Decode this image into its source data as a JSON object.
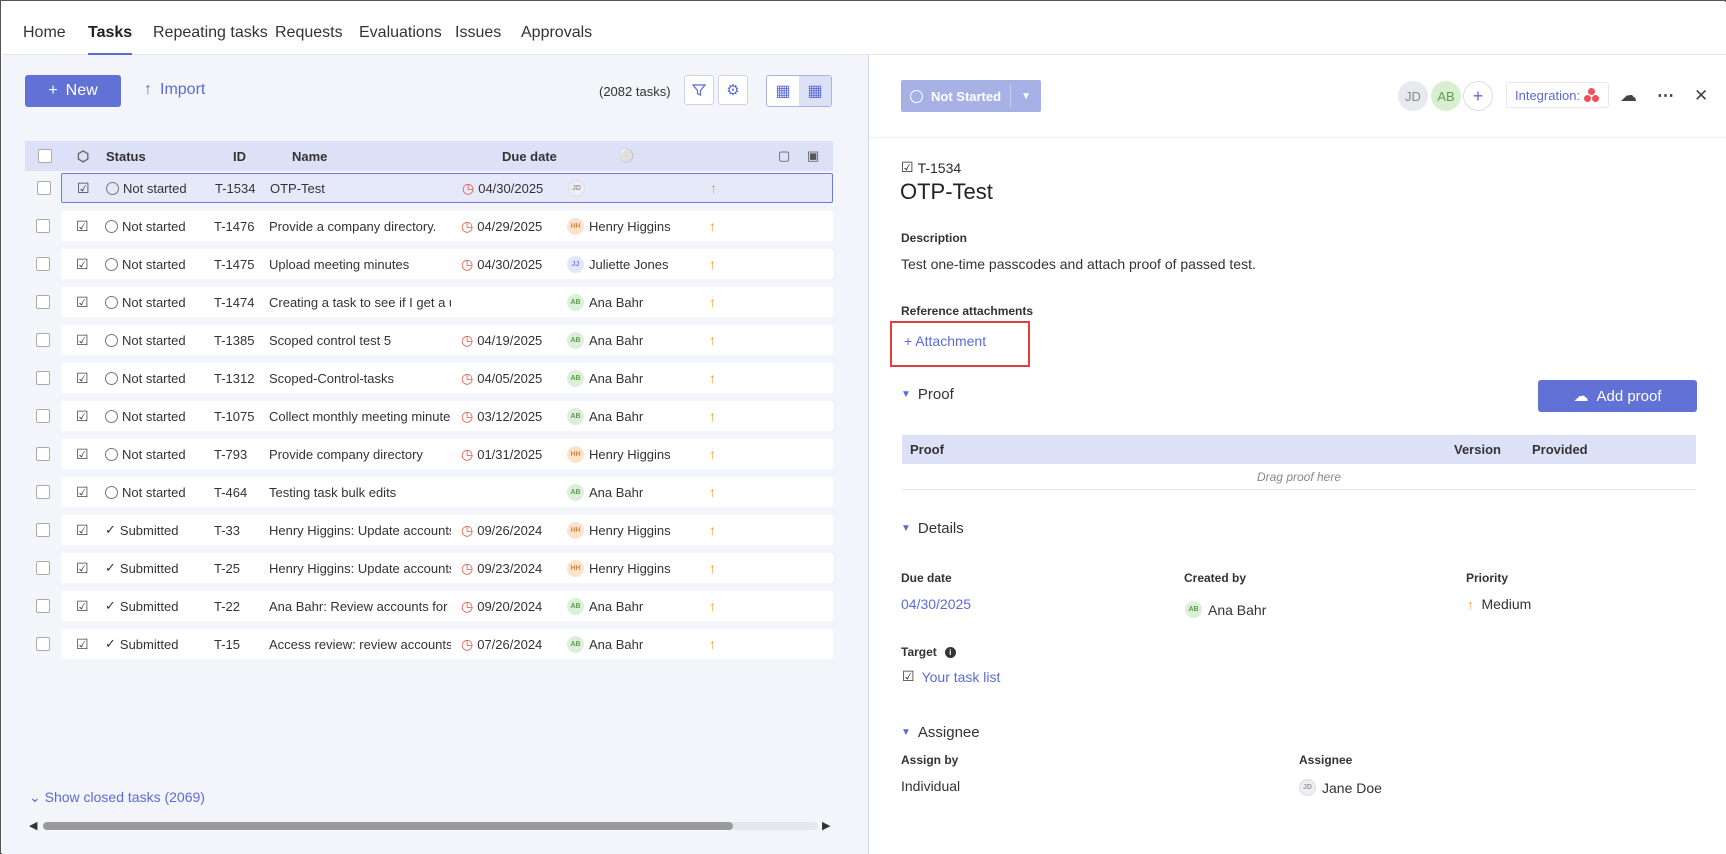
{
  "nav": {
    "tabs": [
      "Home",
      "Tasks",
      "Repeating tasks",
      "Requests",
      "Evaluations",
      "Issues",
      "Approvals"
    ],
    "active": "Tasks"
  },
  "toolbar": {
    "new_label": "New",
    "import_label": "Import",
    "task_count": "(2082 tasks)"
  },
  "table": {
    "headers": {
      "status": "Status",
      "id": "ID",
      "name": "Name",
      "due": "Due date"
    },
    "rows": [
      {
        "status": "Not started",
        "id": "T-1534",
        "name": "OTP-Test",
        "due": "04/30/2025",
        "assignee": "",
        "initials": "JD",
        "av": "jd",
        "selected": true
      },
      {
        "status": "Not started",
        "id": "T-1476",
        "name": "Provide a company directory.",
        "due": "04/29/2025",
        "assignee": "Henry Higgins",
        "initials": "HH",
        "av": "hh"
      },
      {
        "status": "Not started",
        "id": "T-1475",
        "name": "Upload meeting minutes",
        "due": "04/30/2025",
        "assignee": "Juliette Jones",
        "initials": "JJ",
        "av": "jj"
      },
      {
        "status": "Not started",
        "id": "T-1474",
        "name": "Creating a task to see if I get a uni...",
        "due": "",
        "assignee": "Ana Bahr",
        "initials": "AB",
        "av": "ab"
      },
      {
        "status": "Not started",
        "id": "T-1385",
        "name": "Scoped control test 5",
        "due": "04/19/2025",
        "assignee": "Ana Bahr",
        "initials": "AB",
        "av": "ab"
      },
      {
        "status": "Not started",
        "id": "T-1312",
        "name": "Scoped-Control-tasks",
        "due": "04/05/2025",
        "assignee": "Ana Bahr",
        "initials": "AB",
        "av": "ab"
      },
      {
        "status": "Not started",
        "id": "T-1075",
        "name": "Collect monthly meeting minutes",
        "due": "03/12/2025",
        "assignee": "Ana Bahr",
        "initials": "AB",
        "av": "ab"
      },
      {
        "status": "Not started",
        "id": "T-793",
        "name": "Provide company directory",
        "due": "01/31/2025",
        "assignee": "Henry Higgins",
        "initials": "HH",
        "av": "hh"
      },
      {
        "status": "Not started",
        "id": "T-464",
        "name": "Testing task bulk edits",
        "due": "",
        "assignee": "Ana Bahr",
        "initials": "AB",
        "av": "ab"
      },
      {
        "status": "Submitted",
        "id": "T-33",
        "name": "Henry Higgins: Update accounts f...",
        "due": "09/26/2024",
        "assignee": "Henry Higgins",
        "initials": "HH",
        "av": "hh"
      },
      {
        "status": "Submitted",
        "id": "T-25",
        "name": "Henry Higgins: Update accounts f...",
        "due": "09/23/2024",
        "assignee": "Henry Higgins",
        "initials": "HH",
        "av": "hh"
      },
      {
        "status": "Submitted",
        "id": "T-22",
        "name": "Ana Bahr: Review accounts for EU...",
        "due": "09/20/2024",
        "assignee": "Ana Bahr",
        "initials": "AB",
        "av": "ab"
      },
      {
        "status": "Submitted",
        "id": "T-15",
        "name": "Access review: review accounts fo...",
        "due": "07/26/2024",
        "assignee": "Ana Bahr",
        "initials": "AB",
        "av": "ab"
      }
    ],
    "show_closed": "Show closed tasks (2069)"
  },
  "detail": {
    "status_button": "Not Started",
    "avatars": [
      "JD",
      "AB"
    ],
    "integration_label": "Integration:",
    "task_id": "T-1534",
    "title": "OTP-Test",
    "description_label": "Description",
    "description": "Test one-time passcodes and attach proof of passed test.",
    "attachments_label": "Reference attachments",
    "attachment_link": "+ Attachment",
    "proof_section": "Proof",
    "add_proof": "Add proof",
    "proof_columns": [
      "Proof",
      "Version",
      "Provided"
    ],
    "drag_hint": "Drag proof here",
    "details_section": "Details",
    "due_label": "Due date",
    "due_value": "04/30/2025",
    "created_label": "Created by",
    "created_value": "Ana Bahr",
    "created_initials": "AB",
    "priority_label": "Priority",
    "priority_value": "Medium",
    "target_label": "Target",
    "target_value": "Your task list",
    "assignee_section": "Assignee",
    "assign_by_label": "Assign by",
    "assign_by_value": "Individual",
    "assignee_label": "Assignee",
    "assignee_value": "Jane Doe",
    "assignee_initials": "JD"
  },
  "colors": {
    "accent": "#6271d6",
    "header_bg": "#dde1f7",
    "overdue": "#e0533d",
    "priority": "#f0a020",
    "highlight": "#e53e3e"
  }
}
